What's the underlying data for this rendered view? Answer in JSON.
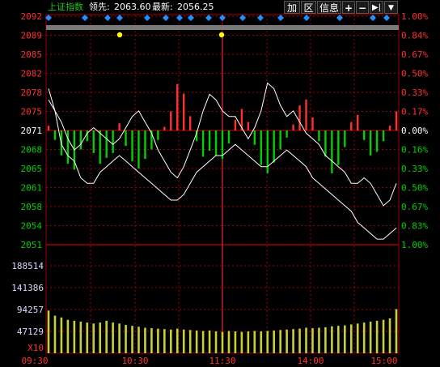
{
  "header": {
    "index_name": "上证指数",
    "leading_label": "领先:",
    "leading_value": "2063.60",
    "last_label": "最新:",
    "last_value": "2056.25"
  },
  "toolbar": {
    "add_label": "加",
    "range_label": "区",
    "info_label": "信息",
    "zoom_in_label": "+",
    "zoom_out_label": "−",
    "jump_icon": "end-icon",
    "menu_icon": "caret-down-icon"
  },
  "price_axis": {
    "left_labels": [
      "2092",
      "2089",
      "2085",
      "2082",
      "2078",
      "2075",
      "2071",
      "2068",
      "2065",
      "2061",
      "2058",
      "2054",
      "2051"
    ],
    "right_labels": [
      "1.00%",
      "0.84%",
      "0.67%",
      "0.50%",
      "0.33%",
      "0.17%",
      "0.00%",
      "0.16%",
      "0.33%",
      "0.50%",
      "0.67%",
      "0.83%",
      "1.00%"
    ]
  },
  "volume_axis": {
    "labels": [
      "188514",
      "141386",
      "94257",
      "47129"
    ],
    "multiplier": "X10"
  },
  "time_axis": {
    "labels": [
      "09:30",
      "10:30",
      "11:30",
      "14:00",
      "15:00"
    ]
  },
  "colors": {
    "up": "#ff3030",
    "down": "#00d000",
    "price_line": "#ffffff",
    "leading_line": "#ffffff",
    "volume": "#c8d038",
    "marker_blue": "#1e90ff",
    "marker_yellow": "#ffff00",
    "grid": "#a00000"
  },
  "chart_data": {
    "type": "line",
    "ylim": [
      2051,
      2092
    ],
    "base": 2071,
    "series": [
      {
        "values": [
          2079,
          2075,
          2069,
          2067,
          2066,
          2063,
          2062,
          2062,
          2064,
          2065,
          2066,
          2067,
          2066,
          2065,
          2064,
          2063,
          2062,
          2061,
          2060,
          2059,
          2059,
          2060,
          2062,
          2064,
          2065,
          2066,
          2067,
          2067,
          2068,
          2069,
          2068,
          2067,
          2066,
          2065,
          2065,
          2066,
          2067,
          2068,
          2067,
          2066,
          2065,
          2063,
          2062,
          2061,
          2060,
          2059,
          2058,
          2057,
          2055,
          2054,
          2053,
          2052,
          2052,
          2053,
          2054
        ]
      },
      {
        "values": [
          2077,
          2075,
          2073,
          2070,
          2068,
          2069,
          2071,
          2072,
          2071,
          2070,
          2069,
          2070,
          2072,
          2074,
          2075,
          2073,
          2071,
          2068,
          2066,
          2064,
          2063,
          2065,
          2068,
          2071,
          2075,
          2078,
          2077,
          2075,
          2074,
          2074,
          2072,
          2070,
          2072,
          2075,
          2080,
          2079,
          2076,
          2074,
          2075,
          2073,
          2071,
          2070,
          2069,
          2067,
          2066,
          2065,
          2064,
          2062,
          2062,
          2063,
          2062,
          2060,
          2058,
          2059,
          2062
        ]
      }
    ],
    "diff_bars": [
      0.4,
      -0.8,
      -2.1,
      -2.8,
      -3.3,
      -1.6,
      -0.9,
      -1.9,
      -2.8,
      -2.3,
      -1.9,
      0.6,
      -1.3,
      -2.6,
      -3.2,
      -2.4,
      -1.6,
      -0.8,
      0.3,
      1.6,
      3.9,
      3.1,
      1.2,
      -0.9,
      -2.2,
      -1.7,
      -2.1,
      -2.4,
      -1.1,
      0.9,
      1.8,
      0.7,
      -1.2,
      -2.9,
      -3.6,
      -2.7,
      -1.6,
      -0.6,
      0.5,
      2.1,
      2.6,
      1.1,
      -0.9,
      -2.2,
      -3.6,
      -2.9,
      -1.4,
      0.7,
      1.3,
      -0.8,
      -2.1,
      -1.8,
      -0.9,
      0.4,
      1.6
    ],
    "volume": [
      92000,
      81000,
      77000,
      72000,
      70000,
      68000,
      66000,
      64000,
      66000,
      70000,
      66000,
      64000,
      61000,
      59000,
      57000,
      55000,
      54000,
      53000,
      52000,
      51000,
      53000,
      51000,
      50000,
      49000,
      48000,
      49000,
      47000,
      46000,
      48000,
      47000,
      46000,
      47000,
      48000,
      47000,
      48000,
      49000,
      50000,
      51000,
      52000,
      53000,
      55000,
      54000,
      55000,
      56000,
      58000,
      59000,
      60000,
      62000,
      64000,
      66000,
      68000,
      70000,
      72000,
      75000,
      95000
    ]
  }
}
